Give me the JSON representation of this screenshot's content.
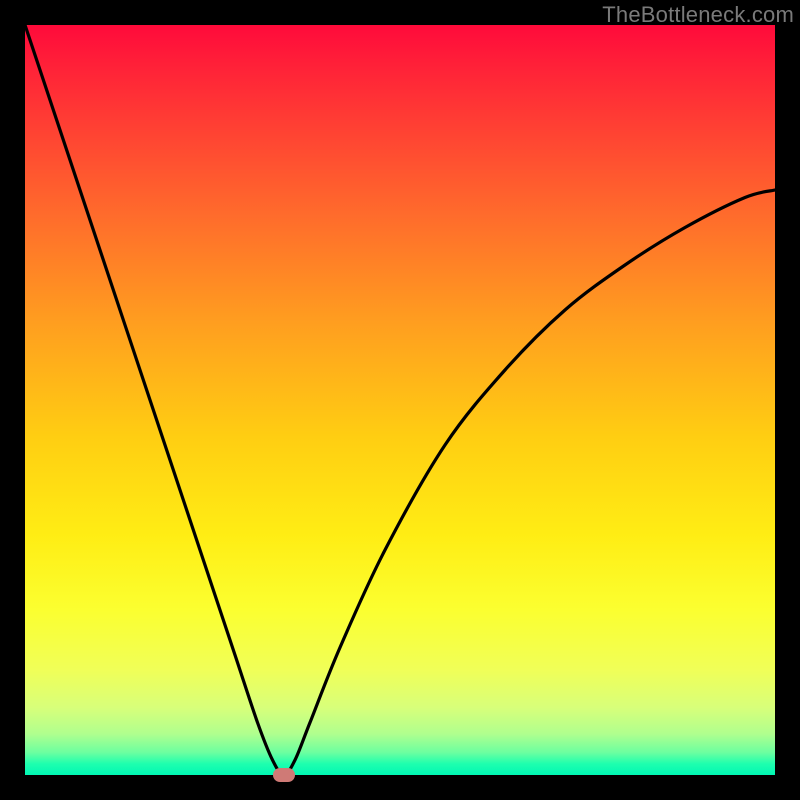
{
  "watermark": "TheBottleneck.com",
  "colors": {
    "frame_border": "#000000",
    "curve_stroke": "#000000",
    "marker_fill": "#cf7a76"
  },
  "chart_data": {
    "type": "line",
    "title": "",
    "xlabel": "",
    "ylabel": "",
    "xlim": [
      0,
      100
    ],
    "ylim": [
      0,
      100
    ],
    "grid": false,
    "legend": false,
    "series": [
      {
        "name": "bottleneck-curve",
        "x": [
          0,
          4,
          8,
          12,
          16,
          20,
          24,
          28,
          31,
          33,
          34.5,
          36,
          38,
          42,
          48,
          56,
          64,
          72,
          80,
          88,
          96,
          100
        ],
        "y": [
          100,
          88,
          76,
          64,
          52,
          40,
          28,
          16,
          7,
          2,
          0,
          2,
          7,
          17,
          30,
          44,
          54,
          62,
          68,
          73,
          77,
          78
        ]
      }
    ],
    "annotations": [
      {
        "name": "minimum-marker",
        "x": 34.5,
        "y": 0
      }
    ]
  }
}
